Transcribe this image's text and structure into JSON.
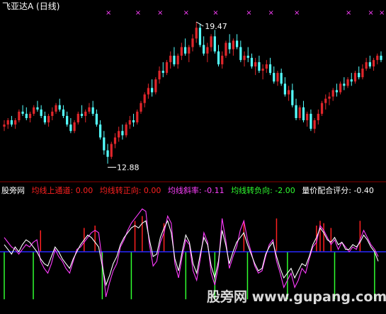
{
  "title": "飞亚达A (日线)",
  "colors": {
    "background": "#000000",
    "up": "#e0262b",
    "down": "#54ffff",
    "signal_marker": "#ff40ff",
    "indicator_white": "#ffffff",
    "indicator_magenta": "#ff3cff",
    "zero_line": "#2828ff",
    "bar_red": "#ff2020",
    "bar_green": "#30ff30",
    "panel_separator": "#8b0000"
  },
  "chart_data": [
    {
      "type": "candlestick",
      "title": "飞亚达A (日线)",
      "annotations": [
        {
          "text": "19.47",
          "value": 19.47,
          "kind": "high"
        },
        {
          "text": "12.88",
          "value": 12.88,
          "kind": "low"
        }
      ],
      "signal_marker": "×",
      "signal_marker_count": 11,
      "ohlc": [
        [
          14.6,
          14.9,
          14.4,
          14.7
        ],
        [
          14.7,
          15.0,
          14.5,
          14.9
        ],
        [
          14.9,
          15.1,
          14.6,
          14.7
        ],
        [
          14.7,
          15.0,
          14.5,
          14.9
        ],
        [
          14.9,
          15.4,
          14.8,
          15.3
        ],
        [
          15.3,
          15.6,
          15.1,
          15.2
        ],
        [
          15.2,
          15.5,
          14.9,
          15.0
        ],
        [
          15.0,
          15.3,
          14.8,
          15.2
        ],
        [
          15.2,
          15.6,
          15.1,
          15.5
        ],
        [
          15.5,
          15.8,
          15.3,
          15.4
        ],
        [
          15.4,
          15.6,
          15.0,
          15.1
        ],
        [
          15.1,
          15.3,
          14.7,
          14.8
        ],
        [
          14.8,
          15.2,
          14.6,
          15.1
        ],
        [
          15.1,
          15.5,
          14.9,
          15.3
        ],
        [
          15.3,
          15.7,
          15.2,
          15.6
        ],
        [
          15.6,
          15.9,
          15.3,
          15.4
        ],
        [
          15.4,
          15.6,
          15.0,
          15.1
        ],
        [
          15.1,
          15.3,
          14.6,
          14.7
        ],
        [
          14.7,
          15.0,
          14.3,
          14.4
        ],
        [
          14.4,
          14.9,
          14.3,
          14.8
        ],
        [
          14.8,
          15.3,
          14.7,
          15.2
        ],
        [
          15.2,
          15.6,
          15.0,
          15.1
        ],
        [
          15.1,
          15.4,
          14.8,
          15.3
        ],
        [
          15.3,
          15.7,
          15.2,
          15.5
        ],
        [
          15.5,
          15.8,
          15.1,
          15.2
        ],
        [
          15.2,
          15.4,
          14.6,
          14.7
        ],
        [
          14.7,
          14.9,
          14.0,
          14.1
        ],
        [
          14.1,
          14.4,
          13.3,
          13.5
        ],
        [
          13.5,
          13.8,
          12.88,
          13.2
        ],
        [
          13.2,
          13.9,
          13.1,
          13.8
        ],
        [
          13.8,
          14.3,
          13.6,
          14.1
        ],
        [
          14.1,
          14.6,
          13.9,
          14.4
        ],
        [
          14.4,
          14.7,
          14.0,
          14.2
        ],
        [
          14.2,
          14.8,
          14.1,
          14.7
        ],
        [
          14.7,
          15.1,
          14.5,
          14.9
        ],
        [
          14.9,
          15.2,
          14.6,
          14.8
        ],
        [
          14.8,
          15.4,
          14.7,
          15.3
        ],
        [
          15.3,
          15.8,
          15.2,
          15.7
        ],
        [
          15.7,
          16.2,
          15.5,
          16.1
        ],
        [
          16.1,
          16.6,
          15.9,
          16.4
        ],
        [
          16.4,
          16.8,
          16.0,
          16.2
        ],
        [
          16.2,
          16.9,
          16.1,
          16.8
        ],
        [
          16.8,
          17.4,
          16.6,
          17.2
        ],
        [
          17.2,
          17.6,
          16.9,
          17.1
        ],
        [
          17.1,
          17.7,
          17.0,
          17.6
        ],
        [
          17.6,
          18.1,
          17.3,
          17.9
        ],
        [
          17.9,
          18.3,
          17.4,
          17.5
        ],
        [
          17.5,
          18.0,
          17.3,
          17.9
        ],
        [
          17.9,
          18.5,
          17.7,
          18.3
        ],
        [
          18.3,
          18.7,
          17.9,
          18.0
        ],
        [
          18.0,
          18.4,
          17.6,
          18.3
        ],
        [
          18.3,
          18.9,
          18.1,
          18.7
        ],
        [
          18.7,
          19.47,
          18.5,
          19.2
        ],
        [
          19.2,
          19.4,
          18.3,
          18.4
        ],
        [
          18.4,
          18.8,
          17.9,
          18.0
        ],
        [
          18.0,
          18.5,
          17.6,
          18.3
        ],
        [
          18.3,
          18.9,
          18.1,
          18.8
        ],
        [
          18.8,
          19.1,
          18.0,
          18.1
        ],
        [
          18.1,
          18.4,
          17.4,
          17.5
        ],
        [
          17.5,
          18.1,
          17.3,
          17.9
        ],
        [
          17.9,
          18.6,
          17.8,
          18.5
        ],
        [
          18.5,
          18.9,
          18.0,
          18.2
        ],
        [
          18.2,
          18.7,
          17.9,
          18.6
        ],
        [
          18.6,
          18.9,
          18.2,
          18.3
        ],
        [
          18.3,
          18.6,
          17.6,
          17.7
        ],
        [
          17.7,
          18.1,
          17.4,
          17.9
        ],
        [
          17.9,
          18.3,
          17.6,
          17.8
        ],
        [
          17.8,
          18.0,
          17.3,
          17.4
        ],
        [
          17.4,
          17.8,
          17.0,
          17.6
        ],
        [
          17.6,
          17.9,
          17.1,
          17.2
        ],
        [
          17.2,
          17.5,
          16.8,
          17.3
        ],
        [
          17.3,
          17.7,
          17.1,
          17.5
        ],
        [
          17.5,
          17.8,
          17.0,
          17.1
        ],
        [
          17.1,
          17.4,
          16.6,
          16.7
        ],
        [
          16.7,
          17.2,
          16.5,
          17.1
        ],
        [
          17.1,
          17.3,
          16.5,
          16.6
        ],
        [
          16.6,
          16.9,
          16.0,
          16.1
        ],
        [
          16.1,
          16.5,
          15.8,
          16.3
        ],
        [
          16.3,
          16.6,
          15.5,
          15.6
        ],
        [
          15.6,
          15.9,
          14.9,
          15.0
        ],
        [
          15.0,
          15.6,
          14.9,
          15.5
        ],
        [
          15.5,
          15.8,
          14.8,
          14.9
        ],
        [
          14.9,
          15.3,
          14.6,
          15.2
        ],
        [
          15.2,
          15.4,
          14.4,
          14.5
        ],
        [
          14.5,
          15.0,
          14.3,
          14.9
        ],
        [
          14.9,
          15.4,
          14.7,
          15.2
        ],
        [
          15.2,
          15.8,
          15.1,
          15.7
        ],
        [
          15.7,
          16.1,
          15.4,
          15.9
        ],
        [
          15.9,
          16.2,
          15.6,
          16.0
        ],
        [
          16.0,
          16.4,
          15.8,
          16.3
        ],
        [
          16.3,
          16.6,
          16.0,
          16.2
        ],
        [
          16.2,
          16.7,
          16.1,
          16.6
        ],
        [
          16.6,
          16.9,
          16.3,
          16.5
        ],
        [
          16.5,
          16.9,
          16.4,
          16.8
        ],
        [
          16.8,
          17.1,
          16.5,
          16.7
        ],
        [
          16.7,
          17.2,
          16.6,
          17.1
        ],
        [
          17.1,
          17.4,
          16.8,
          16.9
        ],
        [
          16.9,
          17.5,
          16.8,
          17.3
        ],
        [
          17.3,
          17.8,
          17.2,
          17.6
        ],
        [
          17.6,
          17.9,
          17.3,
          17.4
        ],
        [
          17.4,
          17.8,
          17.2,
          17.7
        ],
        [
          17.7,
          18.0,
          17.5,
          17.9
        ],
        [
          17.9,
          18.1,
          17.6,
          17.7
        ]
      ]
    },
    {
      "type": "line",
      "legend": [
        {
          "name": "股旁网",
          "value": "",
          "color": "#ffffff"
        },
        {
          "name": "均线上通道",
          "value": "0.00",
          "color": "#ff2020"
        },
        {
          "name": "均线转正向",
          "value": "0.00",
          "color": "#ff2020"
        },
        {
          "name": "均线斜率",
          "value": "-0.11",
          "color": "#ff40ff"
        },
        {
          "name": "均线转负向",
          "value": "-2.00",
          "color": "#30ff30"
        },
        {
          "name": "量价配合评分",
          "value": "-0.40",
          "color": "#ffffff"
        }
      ],
      "zero_level": 0,
      "ylim": [
        -2.5,
        2.2
      ],
      "series": [
        {
          "name": "均线斜率",
          "color": "#ff3cff",
          "values": [
            0.6,
            0.4,
            0.2,
            0.1,
            -0.1,
            0.1,
            0.3,
            0.2,
            0.4,
            0.5,
            -0.4,
            -0.7,
            -0.9,
            -0.5,
            0.1,
            -0.2,
            -0.4,
            -0.7,
            -0.9,
            -0.4,
            0.1,
            0.2,
            0.4,
            0.6,
            0.8,
            0.9,
            0.8,
            -0.4,
            -1.9,
            -1.3,
            -0.8,
            -0.5,
            0.2,
            0.5,
            0.9,
            1.2,
            1.4,
            1.6,
            1.8,
            1.7,
            0.3,
            -0.6,
            -0.4,
            0.4,
            0.8,
            1.5,
            1.2,
            -0.5,
            -1.1,
            -0.2,
            0.5,
            0.3,
            -0.8,
            -1.2,
            -0.3,
            0.8,
            0.4,
            -0.9,
            -1.4,
            -0.6,
            1.4,
            0.5,
            -0.7,
            -0.2,
            0.2,
            0.9,
            1.3,
            0.5,
            0.0,
            -0.6,
            -0.9,
            -0.8,
            -0.2,
            0.3,
            0.5,
            -0.4,
            -0.9,
            -1.5,
            -1.2,
            -0.9,
            -1.5,
            -1.2,
            -0.7,
            -0.9,
            -0.3,
            0.2,
            0.4,
            1.1,
            0.9,
            0.6,
            0.3,
            0.5,
            0.1,
            0.4,
            0.2,
            0.0,
            0.2,
            0.1,
            0.5,
            0.9,
            0.6,
            0.3,
            0.1,
            -0.2
          ]
        },
        {
          "name": "量价配合评分",
          "color": "#ffffff",
          "values": [
            0.3,
            0.1,
            -0.1,
            0.2,
            0.0,
            0.3,
            0.5,
            0.4,
            0.2,
            0.0,
            -0.3,
            -0.5,
            -0.6,
            -0.2,
            0.2,
            0.0,
            -0.3,
            -0.5,
            -0.7,
            -0.3,
            0.0,
            0.3,
            0.5,
            0.7,
            0.6,
            0.4,
            0.2,
            -0.6,
            -1.4,
            -1.0,
            -0.5,
            -0.2,
            0.3,
            0.6,
            0.8,
            1.0,
            1.1,
            1.0,
            1.2,
            1.3,
            0.5,
            -0.2,
            -0.1,
            0.6,
            1.0,
            1.3,
            0.8,
            -0.3,
            -0.8,
            0.0,
            0.7,
            0.4,
            -0.5,
            -0.9,
            -0.1,
            0.6,
            0.3,
            -0.6,
            -1.1,
            -0.4,
            0.9,
            0.3,
            -0.5,
            0.0,
            0.4,
            0.6,
            0.8,
            0.3,
            -0.1,
            -0.5,
            -0.8,
            -0.7,
            -0.1,
            0.2,
            0.4,
            -0.2,
            -0.7,
            -1.1,
            -0.9,
            -0.7,
            -1.1,
            -0.8,
            -0.5,
            -0.6,
            -0.2,
            0.3,
            0.6,
            1.0,
            0.8,
            0.5,
            0.4,
            0.6,
            0.3,
            0.4,
            0.1,
            0.1,
            0.3,
            0.2,
            0.4,
            0.7,
            0.5,
            0.2,
            0.0,
            -0.4
          ]
        }
      ],
      "bars_up_red": [
        0.9,
        1.0,
        1.1,
        1.3,
        1.5,
        1.2,
        1.3,
        1.4,
        1.1,
        1.3,
        1.2,
        1.0,
        1.3
      ],
      "bars_up_red_index": [
        10,
        22,
        25,
        36,
        38,
        44,
        66,
        75,
        86,
        87,
        88,
        90,
        98
      ],
      "bars_down_green": [
        -2.0,
        -2.0,
        -2.0,
        -2.0,
        -2.0,
        -2.0,
        -2.0,
        -2.0,
        -2.0,
        -2.0
      ],
      "bars_down_green_index": [
        0,
        8,
        27,
        35,
        50,
        58,
        67,
        78,
        91,
        102
      ]
    }
  ],
  "watermark": "股旁网 www.gupang.com"
}
